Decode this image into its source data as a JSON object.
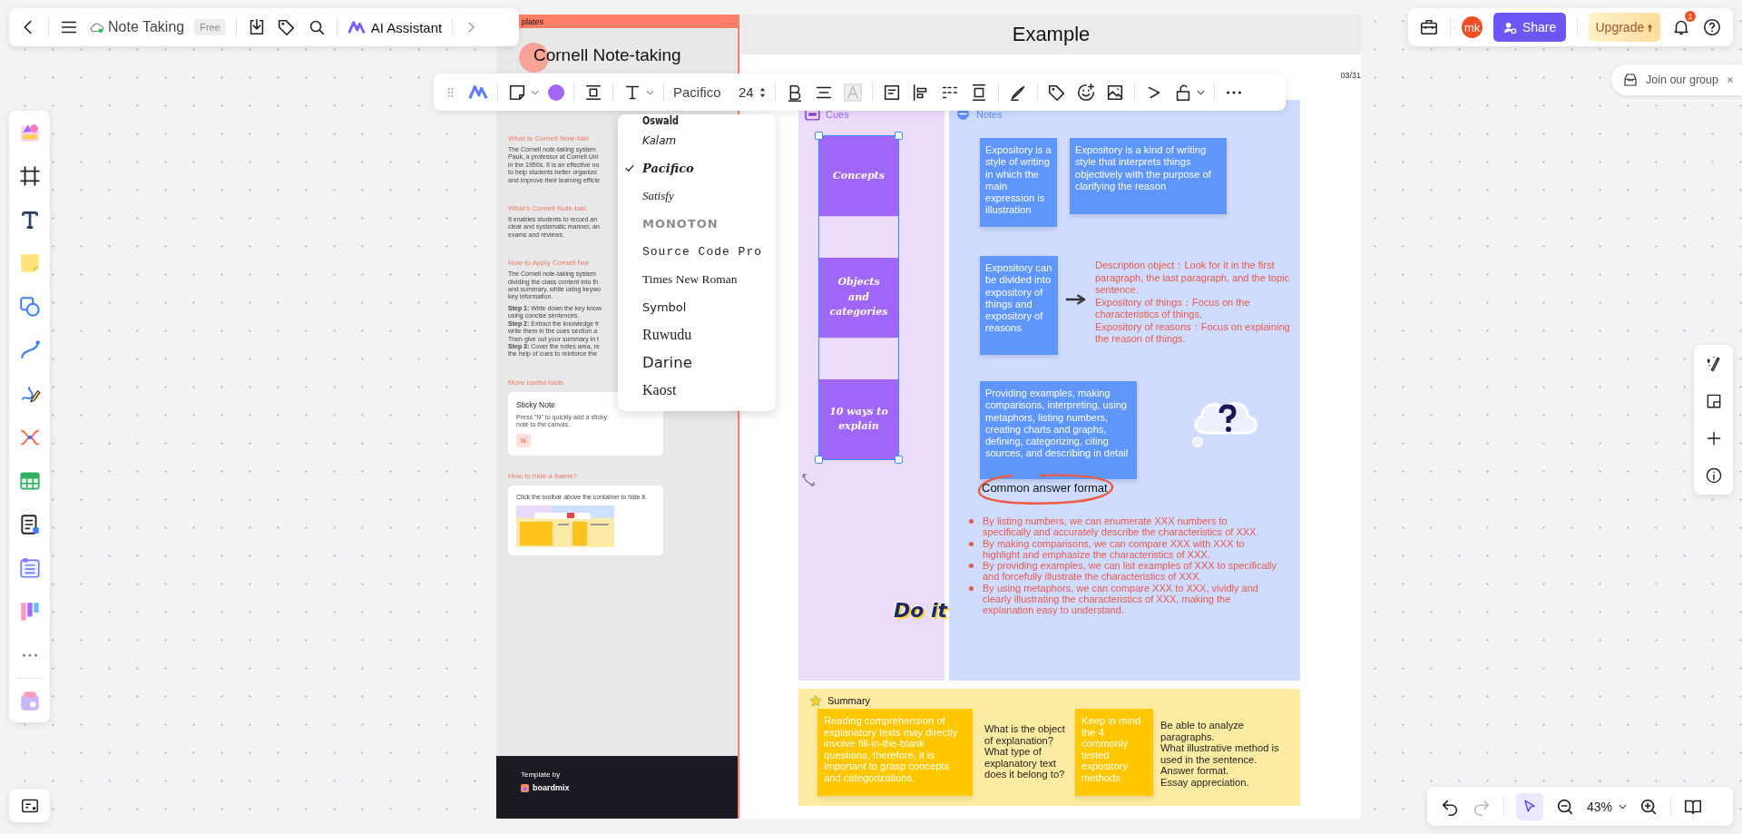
{
  "top_bar": {
    "title": "Note Taking",
    "plan_badge": "Free",
    "ai_button": "AI Assistant"
  },
  "account_bar": {
    "avatar": "mk",
    "share": "Share",
    "upgrade": "Upgrade",
    "notification_count": "1"
  },
  "join_banner": {
    "label": "Join our group"
  },
  "format_toolbar": {
    "font": "Pacifico",
    "font_size": "24"
  },
  "font_menu": [
    {
      "label": "Oswald",
      "kind": "condensed",
      "selected": false
    },
    {
      "label": "Kalam",
      "kind": "hand",
      "selected": false
    },
    {
      "label": "Pacifico",
      "kind": "script",
      "selected": true
    },
    {
      "label": "Satisfy",
      "kind": "thin-script",
      "selected": false
    },
    {
      "label": "MONOTON",
      "kind": "display",
      "selected": false
    },
    {
      "label": "Source Code Pro",
      "kind": "mono",
      "selected": false
    },
    {
      "label": "Times New Roman",
      "kind": "serif",
      "selected": false
    },
    {
      "label": "Symbol",
      "kind": "sans",
      "selected": false
    },
    {
      "label": "Ruwudu",
      "kind": "large-serif",
      "selected": false
    },
    {
      "label": "Darine",
      "kind": "large-sans",
      "selected": false
    },
    {
      "label": "Kaost",
      "kind": "large-serif",
      "selected": false
    }
  ],
  "template_panel": {
    "header": "plates",
    "title": "Cornell Note-taking",
    "sections": [
      {
        "heading": "What Is Cornell Note-taki",
        "paragraphs": [
          [
            "The Cornell note-taking system",
            "Pauk, a professor at Cornell Uni",
            "in the 1950s. It is an effective no",
            "to help students better organize",
            "and improve their learning efficie"
          ]
        ]
      },
      {
        "heading": "What's Cornell Note-taki",
        "paragraphs": [
          [
            "It enables students to record an",
            "clear and systematic manner, an",
            "exams and reviews."
          ]
        ]
      },
      {
        "heading": "How to Apply Cornell Not",
        "paragraphs": [
          [
            "The Cornell note-taking system",
            "dividing the class content into th",
            "and summary, while using keywo",
            "key information."
          ],
          [
            "**Step 1:** Write down the key know",
            "using concise sentences.",
            "**Step 2:** Extract the knowledge fr",
            "write them in the cues section a",
            "Then give out your summary in t",
            "**Step 3:** Cover the notes area, re",
            "the help of cues to reinforce the"
          ]
        ]
      },
      {
        "heading": "More useful tools",
        "card": {
          "kind": "shortcut",
          "title": "Sticky Note",
          "text": "Press \"N\" to quickly add a sticky note to the canvas.",
          "key": "N"
        }
      },
      {
        "heading": "How to hide a frame?",
        "card": {
          "kind": "preview",
          "text": "Click the toolbar above the container to hide it."
        }
      }
    ],
    "footer_caption": "Template by",
    "footer_brand": "boardmix"
  },
  "example": {
    "title": "Example",
    "date": "03/31",
    "cues": {
      "label": "Cues",
      "items": [
        "Concepts",
        "Objects and categories",
        "10 ways to explain"
      ]
    },
    "notes": {
      "label": "Notes",
      "boxes": [
        "Expository is a style of writing in which the main expression is illustration",
        "Expository is a kind of writing style that interprets things objectively with the purpose of clarifying the reason",
        "Expository can be divided into expository of things and expository of reasons",
        "Providing examples, making comparisons, interpreting, using metaphors, listing numbers, creating charts and graphs, defining, categorizing, citing sources, and describing in detail"
      ],
      "explanations": [
        "Description object：Look for it in the first paragraph, the last paragraph, and the topic sentence.",
        "Expository of things：Focus on the characteristics of things.",
        "Expository of reasons：Focus on explaining the reason of things."
      ],
      "answer_heading": "Common answer format",
      "bullets": [
        "By listing numbers, we can enumerate XXX numbers to specifically and accurately describe the characteristics of XXX.",
        "By making comparisons, we can compare XXX with XXX to highlight and emphasize the characteristics of XXX.",
        "By providing examples, we can list examples of XXX to specifically and forcefully illustrate the characteristics of XXX.",
        "By using metaphors, we can compare XXX to XXX, vividly and clearly illustrating the characteristics of XXX, making the explanation easy to understand."
      ]
    },
    "sticker": "Do it",
    "summary": {
      "label": "Summary",
      "items": [
        {
          "kind": "sticky",
          "text": "Reading comprehension of explanatory texts may directly involve fill-in-the-blank questions, therefore, it is important to grasp concepts and categorizations."
        },
        {
          "kind": "plain",
          "text": "What is the object of explanation? What type of explanatory text does it belong to?"
        },
        {
          "kind": "sticky",
          "text": "Keep in mind the 4 commonly tested expository methods"
        },
        {
          "kind": "plain",
          "text": "Be able to analyze paragraphs.\nWhat illustrative method is used in the sentence.\nAnswer format.\nEssay appreciation."
        }
      ]
    }
  },
  "zoom_bar": {
    "pointer_selected": true,
    "zoom": "43%"
  }
}
